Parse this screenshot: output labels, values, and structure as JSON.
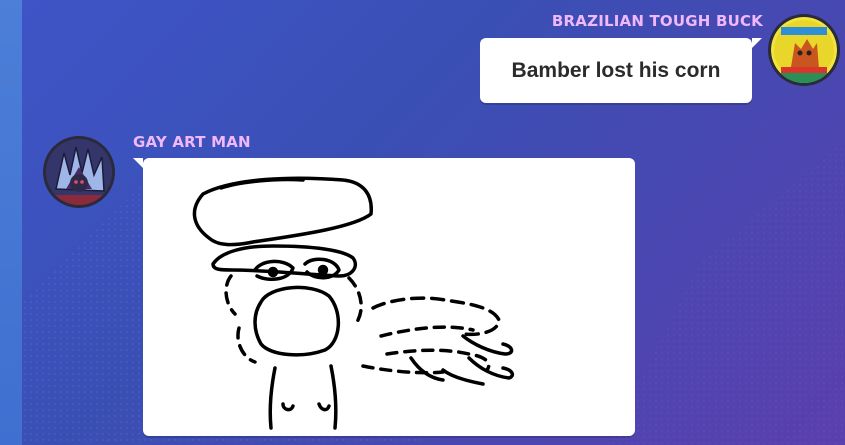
{
  "messages": [
    {
      "author": "BRAZILIAN TOUGH BUCK",
      "text": "Bamber lost his corn",
      "side": "right"
    },
    {
      "author": "GAY ART MAN",
      "attachment": "drawing",
      "side": "left"
    }
  ],
  "colors": {
    "background": "#3f55c8",
    "username": "#f2b8ff",
    "bubble": "#ffffff"
  },
  "icons": {
    "avatar_right": "cartoon-creature-avatar",
    "avatar_left": "spiky-character-avatar"
  }
}
